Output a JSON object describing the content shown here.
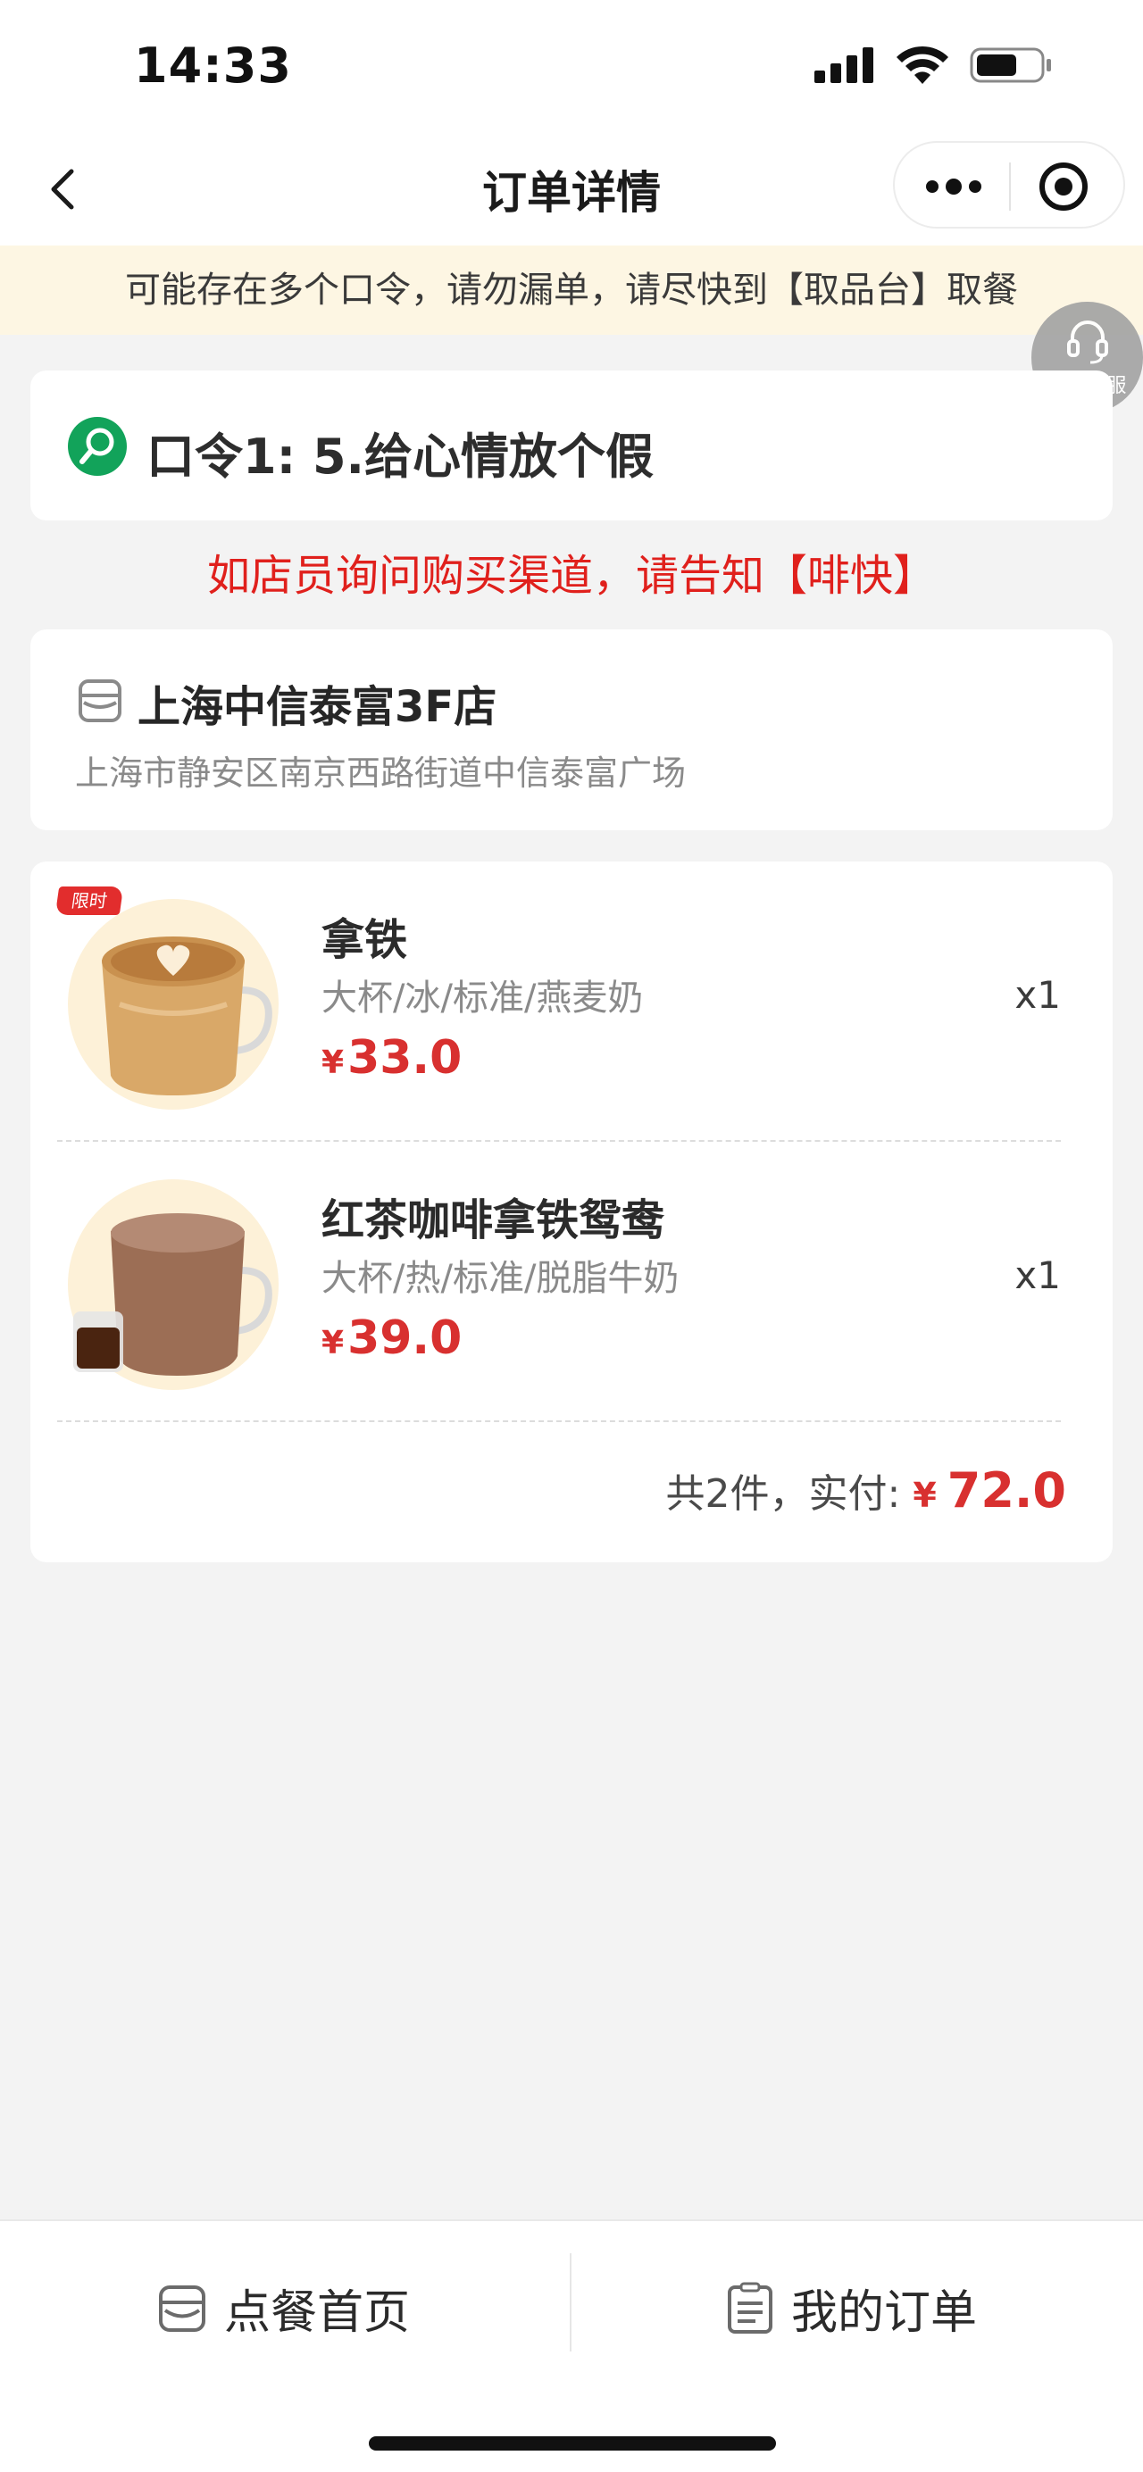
{
  "status_bar": {
    "time": "14:33"
  },
  "navbar": {
    "title": "订单详情"
  },
  "notice": {
    "text": "可能存在多个口令，请勿漏单，请尽快到【取品台】取餐"
  },
  "service": {
    "label": "在线客服"
  },
  "kouling": {
    "text": "口令1:  5.给心情放个假"
  },
  "channel_tip": "如店员询问购买渠道，请告知【啡快】",
  "store": {
    "name": "上海中信泰富3F店",
    "address": "上海市静安区南京西路街道中信泰富广场"
  },
  "order": {
    "items": [
      {
        "badge": "限时",
        "name": "拿铁",
        "spec": "大杯/冰/标准/燕麦奶",
        "currency": "¥",
        "price": "33.0",
        "qty": "x1"
      },
      {
        "name": "红茶咖啡拿铁鸳鸯",
        "spec": "大杯/热/标准/脱脂牛奶",
        "currency": "¥",
        "price": "39.0",
        "qty": "x1"
      }
    ],
    "total_label": "共2件，实付:",
    "total_currency": "¥",
    "total_amount": "72.0"
  },
  "bottom_bar": {
    "home_label": "点餐首页",
    "orders_label": "我的订单"
  },
  "colors": {
    "accent_red": "#d8302f",
    "green": "#12a35a",
    "notice_bg": "#fdf6e3"
  }
}
